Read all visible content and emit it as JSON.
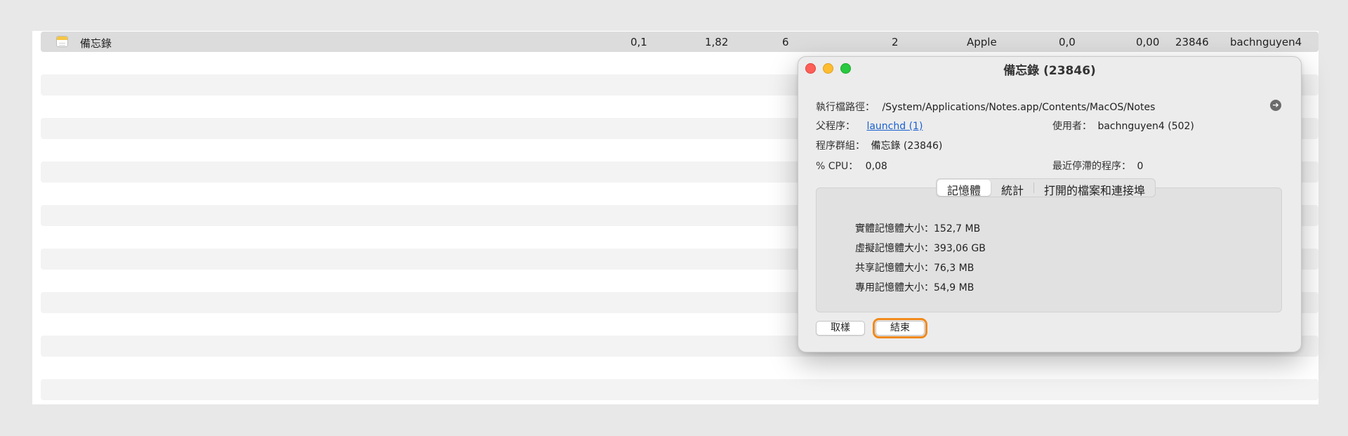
{
  "process_row": {
    "name": "備忘錄",
    "col1": "0,1",
    "col2": "1,82",
    "col3": "6",
    "col4": "2",
    "col5": "Apple",
    "col6": "0,0",
    "col7": "0,00",
    "pid": "23846",
    "user": "bachnguyen4",
    "icon": "notes-icon"
  },
  "dialog": {
    "title": "備忘錄 (23846)",
    "exec_path_label": "執行檔路徑：",
    "exec_path_value": "/System/Applications/Notes.app/Contents/MacOS/Notes",
    "parent_label": "父程序：",
    "parent_value": "launchd (1)",
    "user_label": "使用者：",
    "user_value": "bachnguyen4 (502)",
    "group_label": "程序群組：",
    "group_value": "備忘錄 (23846)",
    "cpu_label": "% CPU：",
    "cpu_value": "0,08",
    "recent_label": "最近停滯的程序：",
    "recent_value": "0",
    "tabs": [
      {
        "label": "記憶體",
        "active": true
      },
      {
        "label": "統計",
        "active": false
      },
      {
        "label": "打開的檔案和連接埠",
        "active": false
      }
    ],
    "memory": [
      {
        "label": "實體記憶體大小：",
        "value": "152,7 MB"
      },
      {
        "label": "虛擬記憶體大小：",
        "value": "393,06 GB"
      },
      {
        "label": "共享記憶體大小：",
        "value": "76,3 MB"
      },
      {
        "label": "專用記憶體大小：",
        "value": "54,9 MB"
      }
    ],
    "cancel_label": "取樣",
    "quit_label": "結束",
    "highlight_color": "#f08a1c",
    "link_color": "#1a5fd0"
  }
}
